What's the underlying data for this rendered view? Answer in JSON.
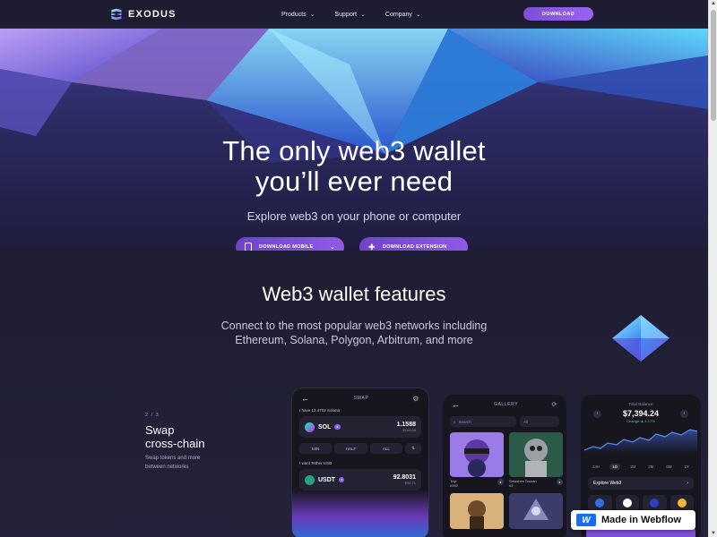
{
  "brand": {
    "name": "EXODUS",
    "accent": "#7b4fd6"
  },
  "nav": {
    "links": [
      {
        "label": "Products",
        "icon": "chevron-down-icon"
      },
      {
        "label": "Support",
        "icon": "chevron-down-icon"
      },
      {
        "label": "Company",
        "icon": "chevron-down-icon"
      }
    ],
    "download_label": "DOWNLOAD"
  },
  "hero": {
    "title_line1": "The only web3 wallet",
    "title_line2": "you’ll ever need",
    "subtitle": "Explore web3 on your phone or computer",
    "btn_mobile": "DOWNLOAD MOBILE",
    "btn_extension": "DOWNLOAD EXTENSION"
  },
  "features": {
    "title": "Web3 wallet features",
    "subtitle_line1": "Connect to the most popular web3 networks including",
    "subtitle_line2": "Ethereum, Solana, Polygon, Arbitrum, and more",
    "step": "2 / 3",
    "swap_title_line1": "Swap",
    "swap_title_line2": "cross-chain",
    "swap_desc_line1": "Swap tokens and more",
    "swap_desc_line2": "between networks"
  },
  "swap_phone": {
    "header": "SWAP",
    "have_label": "I have 12.4702 Solana",
    "from": {
      "symbol": "SOL",
      "amount": "1.1588",
      "fiat": "$100.00"
    },
    "chips": [
      "MIN",
      "HALF",
      "ALL"
    ],
    "want_label": "I want Tether USD",
    "to": {
      "symbol": "USDT",
      "amount": "92.8031",
      "fiat": "$92.71"
    }
  },
  "gallery_phone": {
    "header": "GALLERY",
    "search_placeholder": "Search",
    "filter": "All",
    "items": [
      {
        "name": "Tuyi",
        "id": "#992"
      },
      {
        "name": "Smashes Toucan",
        "id": "#2"
      }
    ]
  },
  "portfolio_phone": {
    "label": "Total Balance",
    "balance": "$7,394.24",
    "change": "Change ▲ 4.17%",
    "ranges": [
      "24H",
      "1D",
      "1M",
      "3M",
      "6M",
      "1Y"
    ],
    "active_range": "1D",
    "explore": "Explore Web3"
  },
  "badge": {
    "text": "Made in Webflow",
    "logo": "W"
  }
}
